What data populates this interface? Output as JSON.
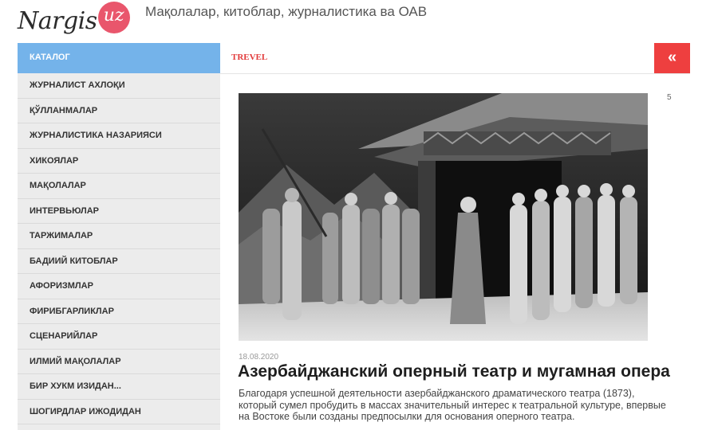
{
  "header": {
    "logo_text": "Nargis",
    "logo_domain": "uz",
    "tagline": "Мақолалар, китоблар, журналистика ва ОАВ"
  },
  "sidebar": {
    "title": "КАТАЛОГ",
    "items": [
      {
        "label": "ЖУРНАЛИСТ АХЛОҚИ"
      },
      {
        "label": "ҚЎЛЛАНМАЛАР"
      },
      {
        "label": "ЖУРНАЛИСТИКА НАЗАРИЯСИ"
      },
      {
        "label": "ХИКОЯЛАР"
      },
      {
        "label": "МАҚОЛАЛАР"
      },
      {
        "label": "ИНТЕРВЬЮЛАР"
      },
      {
        "label": "ТАРЖИМАЛАР"
      },
      {
        "label": "БАДИИЙ КИТОБЛАР"
      },
      {
        "label": "АФОРИЗМЛАР"
      },
      {
        "label": "ФИРИБГАРЛИКЛАР"
      },
      {
        "label": "СЦЕНАРИЙЛАР"
      },
      {
        "label": "ИЛМИЙ МАҚОЛАЛАР"
      },
      {
        "label": "БИР ХУКМ ИЗИДАН..."
      },
      {
        "label": "ШОГИРДЛАР ИЖОДИДАН"
      }
    ]
  },
  "topbar": {
    "breadcrumb": "TREVEL",
    "back_label": "«"
  },
  "article": {
    "image_count": "5",
    "date": "18.08.2020",
    "title": "Азербайджанский оперный театр и мугамная опера",
    "excerpt": "Благодаря успешной деятельности азербайджанского драматического театра (1873), который сумел пробудить в массах значительный интерес к театральной культуре, впервые на Востоке были созданы предпосылки для основания оперного театра."
  },
  "colors": {
    "sidebar_header": "#74b3ea",
    "sidebar_bg": "#ececec",
    "accent_red": "#ee3f3f",
    "logo_pink": "#e9566c"
  }
}
